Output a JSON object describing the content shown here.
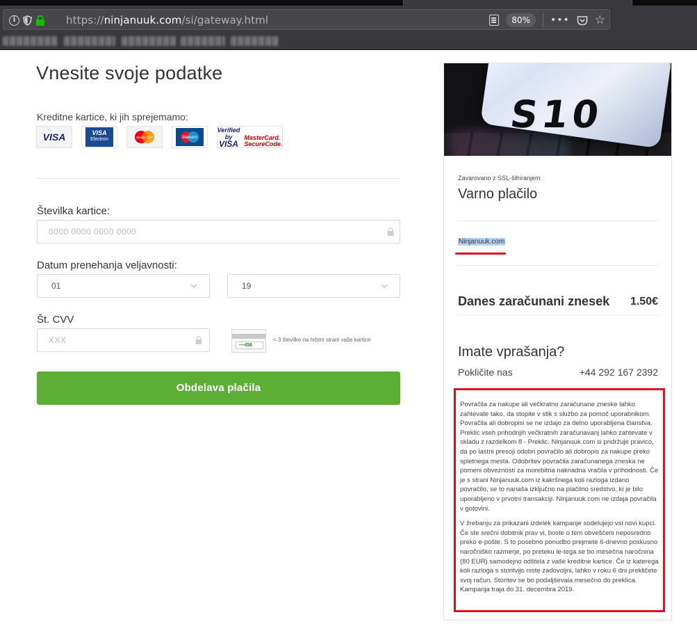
{
  "browser": {
    "url_prefix": "https://",
    "url_host": "ninjanuuk.com",
    "url_path": "/si/gateway.html",
    "zoom": "80%",
    "overflow_label": "•••"
  },
  "form": {
    "title": "Vnesite svoje podatke",
    "cards_label": "Kreditne kartice, ki jih sprejemamo:",
    "card_logos": {
      "visa": "VISA",
      "electron_top": "VISA",
      "electron_bottom": "Electron",
      "mastercard": "MasterCard",
      "maestro": "Maestro",
      "verified_by": "Verified by",
      "verified_visa": "VISA",
      "mc_secure_1": "MasterCard.",
      "mc_secure_2": "SecureCode."
    },
    "card_number_label": "Številka kartice:",
    "card_number_placeholder": "0000 0000 0000 0000",
    "expiry_label": "Datum prenehanja veljavnosti:",
    "expiry_month": "01",
    "expiry_year": "19",
    "cvv_label": "Št. CVV",
    "cvv_placeholder": "XXX",
    "cvv_card_mask": "•••",
    "cvv_card_digits": "456",
    "cvv_hint": "< 3 številke na hrbtni strani vaše kartice",
    "submit_label": "Obdelava plačila"
  },
  "summary": {
    "hero_text": "S10",
    "ssl_label": "Zavarovano z SSL-šifriranjem",
    "title": "Varno plačilo",
    "merchant": "Ninjanuuk.com",
    "charge_label": "Danes zaračunani znesek",
    "charge_amount": "1.50€",
    "questions_title": "Imate vprašanja?",
    "call_label": "Pokličite nas",
    "call_number": "+44 292 167 2392",
    "terms_p1": "Povračila za nakupe ali večkratno zaračunane zneske lahko zahtevate tako, da stopite v stik s službo za pomoč uporabnikom. Povračila ali dobropisi se ne izdajo za delno uporabljena članstva. Preklic vseh prihodnjih večkratnih zaračunavanj lahko zahtevate v skladu z razdelkom 8 - Preklic. Ninjanuuk.com si pridržuje pravico, da po lastni presoji odobri povračilo ali dobropis za nakupe preko spletnega mesta. Odobritev povračila zaračunanega zneska ne pomeni obveznosti za morebitna naknadna vračila v prihodnosti. Če je s strani Ninjanuuk.com iz kakršnega koli razloga izdano povračilo, se to nanaša izključno na plačilno sredstvo, ki je bilo uporabljeno v prvotni transakciji. Ninjanuuk.com ne izdaja povračila v gotovini.",
    "terms_p2": "V žrebanju za prikazani izdelek kampanje sodelujejo vsi novi kupci. Če ste srečni dobitnik prav vi, boste o tem obveščeni neposredno preko e-pošte. S to posebno ponudbo prejmete 6-dnevno poskusno naročniško razmerje, po preteku le-tega se bo mesečna naročnina (80 EUR) samodejno odštela z vaše kreditne kartice. Če iz katerega koli razloga s storitvijo niste zadovoljni, lahko v roku 6 dni prekličete svoj račun. Storitev se bo podaljševala mesečno do preklica. Kampanja traja do 31. decembra 2019."
  },
  "colors": {
    "accent_button": "#5cae34",
    "annotation_red": "#e0121f",
    "highlight": "#b7d3f2"
  }
}
